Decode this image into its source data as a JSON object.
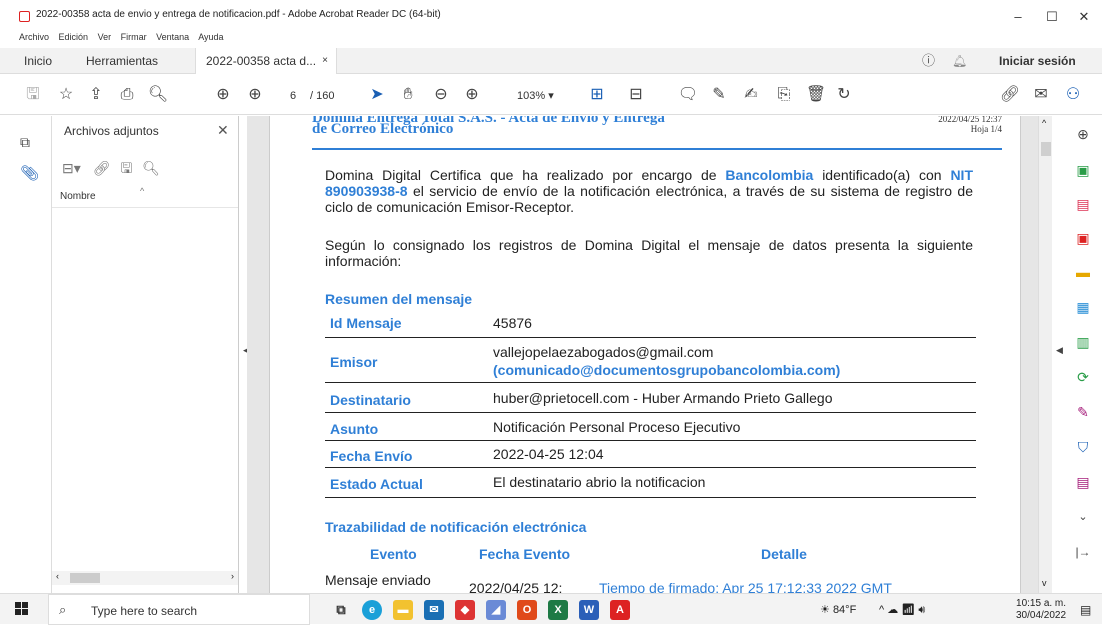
{
  "window": {
    "title": "2022-00358 acta de envio y entrega de notificacion.pdf - Adobe Acrobat Reader DC (64-bit)",
    "minimize": "–",
    "maximize": "☐",
    "close": "✕"
  },
  "menu": [
    "Archivo",
    "Edición",
    "Ver",
    "Firmar",
    "Ventana",
    "Ayuda"
  ],
  "tabs": {
    "home": "Inicio",
    "tools": "Herramientas",
    "document": "2022-00358 acta d...",
    "document_close": "×",
    "signin": "Iniciar sesión"
  },
  "toolbar": {
    "page_current": "6",
    "page_total": "/ 160",
    "zoom": "103%"
  },
  "attachments_panel": {
    "title": "Archivos adjuntos",
    "column_name": "Nombre"
  },
  "document": {
    "header_line1": "Domina Entrega Total S.A.S. - Acta de Envío y Entrega",
    "header_line2": "de Correo Electrónico",
    "header_date": "2022/04/25 12:37",
    "header_page": "Hoja 1/4",
    "intro_part1": "Domina Digital Certifica que ha realizado por encargo de ",
    "intro_company": "Bancolombia",
    "intro_part2": " identificado(a) con ",
    "intro_nit": "NIT 890903938-8",
    "intro_part3": " el servicio de envío de la notificación electrónica, a través de su sistema de registro de ciclo de comunicación Emisor-Receptor.",
    "para2": "Según lo consignado los registros de Domina Digital el mensaje de datos presenta la siguiente información:",
    "summary_title": "Resumen del mensaje",
    "rows": [
      {
        "key": "Id Mensaje",
        "value": "45876"
      },
      {
        "key": "Emisor",
        "value": "vallejopelaezabogados@gmail.com",
        "value2": "(comunicado@documentosgrupobancolombia.com)"
      },
      {
        "key": "Destinatario",
        "value": "huber@prietocell.com - Huber Armando Prieto Gallego"
      },
      {
        "key": "Asunto",
        "value": "Notificación Personal Proceso Ejecutivo"
      },
      {
        "key": "Fecha Envío",
        "value": "2022-04-25 12:04"
      },
      {
        "key": "Estado Actual",
        "value": "El destinatario abrio la notificacion"
      }
    ],
    "trace_title": "Trazabilidad de notificación electrónica",
    "trace_cols": [
      "Evento",
      "Fecha Evento",
      "Detalle"
    ],
    "trace_row1_event": "Mensaje enviado",
    "trace_row1_date": "2022/04/25 12:",
    "trace_row1_detail": "Tiempo de firmado: Apr 25 17:12:33 2022 GMT"
  },
  "taskbar": {
    "search_placeholder": "Type here to search",
    "weather": "84°F",
    "time": "10:15 a. m.",
    "date": "30/04/2022"
  },
  "colors": {
    "accent": "#2f7fd6",
    "acrobat_red": "#d22"
  }
}
